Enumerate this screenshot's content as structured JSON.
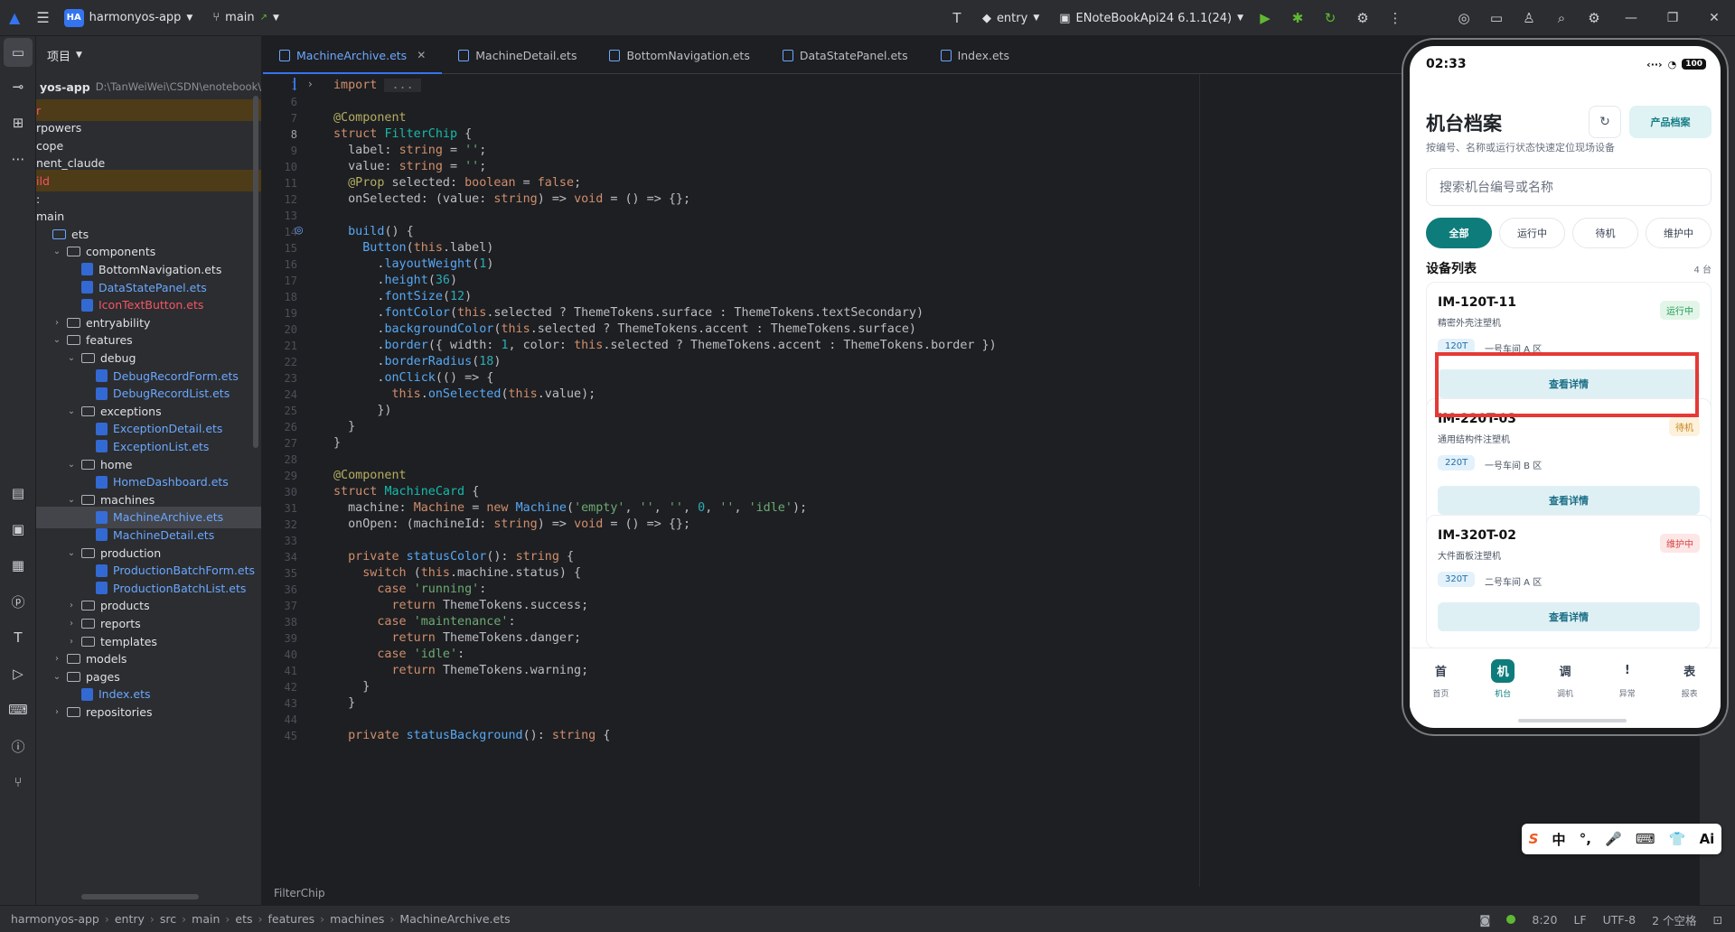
{
  "titlebar": {
    "project_badge": "HA",
    "project_name": "harmonyos-app",
    "branch": "main",
    "run_config": "entry",
    "device": "ENoteBookApi24 6.1.1(24)"
  },
  "project_panel": {
    "title": "项目",
    "root_name": "yos-app",
    "root_path": "D:\\TanWeiWei\\CSDN\\enotebook\\",
    "rows": [
      {
        "label": "r",
        "indent": 0,
        "type": "text",
        "state": "hl",
        "color": "red"
      },
      {
        "label": "rpowers",
        "indent": 0,
        "type": "text"
      },
      {
        "label": "cope",
        "indent": 0,
        "type": "text"
      },
      {
        "label": "nent_claude",
        "indent": 0,
        "type": "text"
      },
      {
        "label": "ild",
        "indent": 0,
        "type": "text",
        "state": "hl",
        "color": "red"
      },
      {
        "label": ":",
        "indent": 0,
        "type": "text"
      },
      {
        "label": "main",
        "indent": 0,
        "type": "text"
      },
      {
        "label": "ets",
        "indent": 0,
        "type": "folder"
      },
      {
        "label": "components",
        "indent": 1,
        "type": "folder",
        "arrow": "open"
      },
      {
        "label": "BottomNavigation.ets",
        "indent": 2,
        "type": "file"
      },
      {
        "label": "DataStatePanel.ets",
        "indent": 2,
        "type": "file",
        "color": "blue"
      },
      {
        "label": "IconTextButton.ets",
        "indent": 2,
        "type": "file",
        "color": "red"
      },
      {
        "label": "entryability",
        "indent": 1,
        "type": "folder",
        "arrow": "closed"
      },
      {
        "label": "features",
        "indent": 1,
        "type": "folder",
        "arrow": "open"
      },
      {
        "label": "debug",
        "indent": 2,
        "type": "folder",
        "arrow": "open"
      },
      {
        "label": "DebugRecordForm.ets",
        "indent": 3,
        "type": "file",
        "color": "blue"
      },
      {
        "label": "DebugRecordList.ets",
        "indent": 3,
        "type": "file",
        "color": "blue"
      },
      {
        "label": "exceptions",
        "indent": 2,
        "type": "folder",
        "arrow": "open"
      },
      {
        "label": "ExceptionDetail.ets",
        "indent": 3,
        "type": "file",
        "color": "blue"
      },
      {
        "label": "ExceptionList.ets",
        "indent": 3,
        "type": "file",
        "color": "blue"
      },
      {
        "label": "home",
        "indent": 2,
        "type": "folder",
        "arrow": "open"
      },
      {
        "label": "HomeDashboard.ets",
        "indent": 3,
        "type": "file",
        "color": "blue"
      },
      {
        "label": "machines",
        "indent": 2,
        "type": "folder",
        "arrow": "open"
      },
      {
        "label": "MachineArchive.ets",
        "indent": 3,
        "type": "file",
        "color": "blue",
        "state": "sel"
      },
      {
        "label": "MachineDetail.ets",
        "indent": 3,
        "type": "file",
        "color": "blue"
      },
      {
        "label": "production",
        "indent": 2,
        "type": "folder",
        "arrow": "open"
      },
      {
        "label": "ProductionBatchForm.ets",
        "indent": 3,
        "type": "file",
        "color": "blue"
      },
      {
        "label": "ProductionBatchList.ets",
        "indent": 3,
        "type": "file",
        "color": "blue"
      },
      {
        "label": "products",
        "indent": 2,
        "type": "folder",
        "arrow": "closed"
      },
      {
        "label": "reports",
        "indent": 2,
        "type": "folder",
        "arrow": "closed"
      },
      {
        "label": "templates",
        "indent": 2,
        "type": "folder",
        "arrow": "closed"
      },
      {
        "label": "models",
        "indent": 1,
        "type": "folder",
        "arrow": "closed"
      },
      {
        "label": "pages",
        "indent": 1,
        "type": "folder",
        "arrow": "open"
      },
      {
        "label": "Index.ets",
        "indent": 2,
        "type": "file",
        "color": "blue"
      },
      {
        "label": "repositories",
        "indent": 1,
        "type": "folder",
        "arrow": "closed"
      }
    ]
  },
  "tabs": [
    {
      "label": "MachineArchive.ets",
      "active": true,
      "closable": true
    },
    {
      "label": "MachineDetail.ets"
    },
    {
      "label": "BottomNavigation.ets"
    },
    {
      "label": "DataStatePanel.ets"
    },
    {
      "label": "Index.ets"
    }
  ],
  "code": {
    "current_line": "8",
    "lines": [
      {
        "n": "1",
        "html": "<span class='k'>import</span> <span class='g' style='background:#2b2d30'> ... </span>"
      },
      {
        "n": "6",
        "html": ""
      },
      {
        "n": "7",
        "html": "<span class='a'>@Component</span>"
      },
      {
        "n": "8",
        "html": "<span class='k'>struct</span> <span class='ty'>FilterChip</span> <span class='t'>{</span>"
      },
      {
        "n": "9",
        "html": "  <span class='t'>label: </span><span class='k'>string</span> <span class='t'>= </span><span class='s'>''</span><span class='t'>;</span>"
      },
      {
        "n": "10",
        "html": "  <span class='t'>value: </span><span class='k'>string</span> <span class='t'>= </span><span class='s'>''</span><span class='t'>;</span>"
      },
      {
        "n": "11",
        "html": "  <span class='a'>@Prop</span> <span class='t'>selected: </span><span class='k'>boolean</span> <span class='t'>= </span><span class='k'>false</span><span class='t'>;</span>"
      },
      {
        "n": "12",
        "html": "  <span class='t'>onSelected: (value: </span><span class='k'>string</span><span class='t'>) => </span><span class='k'>void</span> <span class='t'>= () => {};</span>"
      },
      {
        "n": "13",
        "html": ""
      },
      {
        "n": "14",
        "html": "  <span class='f'>build</span><span class='t'>() {</span>"
      },
      {
        "n": "15",
        "html": "    <span class='f'>Button</span><span class='t'>(</span><span class='k'>this</span><span class='t'>.label)</span>"
      },
      {
        "n": "16",
        "html": "      <span class='t'>.</span><span class='f'>layoutWeight</span><span class='t'>(</span><span class='n'>1</span><span class='t'>)</span>"
      },
      {
        "n": "17",
        "html": "      <span class='t'>.</span><span class='f'>height</span><span class='t'>(</span><span class='n'>36</span><span class='t'>)</span>"
      },
      {
        "n": "18",
        "html": "      <span class='t'>.</span><span class='f'>fontSize</span><span class='t'>(</span><span class='n'>12</span><span class='t'>)</span>"
      },
      {
        "n": "19",
        "html": "      <span class='t'>.</span><span class='f'>fontColor</span><span class='t'>(</span><span class='k'>this</span><span class='t'>.selected ? ThemeTokens.surface : ThemeTokens.textSecondary)</span>"
      },
      {
        "n": "20",
        "html": "      <span class='t'>.</span><span class='f'>backgroundColor</span><span class='t'>(</span><span class='k'>this</span><span class='t'>.selected ? ThemeTokens.accent : ThemeTokens.surface)</span>"
      },
      {
        "n": "21",
        "html": "      <span class='t'>.</span><span class='f'>border</span><span class='t'>({ width: </span><span class='n'>1</span><span class='t'>, color: </span><span class='k'>this</span><span class='t'>.selected ? ThemeTokens.accent : ThemeTokens.border })</span>"
      },
      {
        "n": "22",
        "html": "      <span class='t'>.</span><span class='f'>borderRadius</span><span class='t'>(</span><span class='n'>18</span><span class='t'>)</span>"
      },
      {
        "n": "23",
        "html": "      <span class='t'>.</span><span class='f'>onClick</span><span class='t'>(() => {</span>"
      },
      {
        "n": "24",
        "html": "        <span class='k'>this</span><span class='t'>.</span><span class='f'>onSelected</span><span class='t'>(</span><span class='k'>this</span><span class='t'>.value);</span>"
      },
      {
        "n": "25",
        "html": "      <span class='t'>})</span>"
      },
      {
        "n": "26",
        "html": "  <span class='t'>}</span>"
      },
      {
        "n": "27",
        "html": "<span class='t'>}</span>"
      },
      {
        "n": "28",
        "html": ""
      },
      {
        "n": "29",
        "html": "<span class='a'>@Component</span>"
      },
      {
        "n": "30",
        "html": "<span class='k'>struct</span> <span class='ty'>MachineCard</span> <span class='t'>{</span>"
      },
      {
        "n": "31",
        "html": "  <span class='t'>machine: </span><span class='k'>Machine</span> <span class='t'>= </span><span class='k'>new</span> <span class='f'>Machine</span><span class='t'>(</span><span class='s'>'empty'</span><span class='t'>, </span><span class='s'>''</span><span class='t'>, </span><span class='s'>''</span><span class='t'>, </span><span class='n'>0</span><span class='t'>, </span><span class='s'>''</span><span class='t'>, </span><span class='s'>'idle'</span><span class='t'>);</span>"
      },
      {
        "n": "32",
        "html": "  <span class='t'>onOpen: (machineId: </span><span class='k'>string</span><span class='t'>) => </span><span class='k'>void</span> <span class='t'>= () => {};</span>"
      },
      {
        "n": "33",
        "html": ""
      },
      {
        "n": "34",
        "html": "  <span class='k'>private</span> <span class='f'>statusColor</span><span class='t'>(): </span><span class='k'>string</span> <span class='t'>{</span>"
      },
      {
        "n": "35",
        "html": "    <span class='k'>switch</span> <span class='t'>(</span><span class='k'>this</span><span class='t'>.machine.status) {</span>"
      },
      {
        "n": "36",
        "html": "      <span class='k'>case</span> <span class='s'>'running'</span><span class='t'>:</span>"
      },
      {
        "n": "37",
        "html": "        <span class='k'>return</span> <span class='t'>ThemeTokens.success;</span>"
      },
      {
        "n": "38",
        "html": "      <span class='k'>case</span> <span class='s'>'maintenance'</span><span class='t'>:</span>"
      },
      {
        "n": "39",
        "html": "        <span class='k'>return</span> <span class='t'>ThemeTokens.danger;</span>"
      },
      {
        "n": "40",
        "html": "      <span class='k'>case</span> <span class='s'>'idle'</span><span class='t'>:</span>"
      },
      {
        "n": "41",
        "html": "        <span class='k'>return</span> <span class='t'>ThemeTokens.warning;</span>"
      },
      {
        "n": "42",
        "html": "    <span class='t'>}</span>"
      },
      {
        "n": "43",
        "html": "  <span class='t'>}</span>"
      },
      {
        "n": "44",
        "html": ""
      },
      {
        "n": "45",
        "html": "  <span class='k'>private</span> <span class='f'>statusBackground</span><span class='t'>(): </span><span class='k'>string</span> <span class='t'>{</span>"
      }
    ]
  },
  "editor_breadcrumb": "FilterChip",
  "statusbar": {
    "crumbs": [
      "harmonyos-app",
      "entry",
      "src",
      "main",
      "ets",
      "features",
      "machines",
      "MachineArchive.ets"
    ],
    "position": "8:20",
    "line_sep": "LF",
    "encoding": "UTF-8",
    "indent": "2 个空格"
  },
  "phone": {
    "time": "02:33",
    "battery": "100",
    "title": "机台档案",
    "subtitle": "按编号、名称或运行状态快速定位现场设备",
    "product_button": "产品档案",
    "search_placeholder": "搜索机台编号或名称",
    "chips": [
      "全部",
      "运行中",
      "待机",
      "维护中"
    ],
    "list_title": "设备列表",
    "list_count": "4 台",
    "detail_label": "查看详情",
    "cards": [
      {
        "id": "IM-120T-11",
        "name": "精密外壳注塑机",
        "status": "运行中",
        "ton": "120T",
        "area": "一号车间 A 区",
        "status_bg": "#e3f5e8",
        "status_fg": "#1f9d55"
      },
      {
        "id": "IM-220T-03",
        "name": "通用结构件注塑机",
        "status": "待机",
        "ton": "220T",
        "area": "一号车间 B 区",
        "status_bg": "#fdf1dc",
        "status_fg": "#c7851b"
      },
      {
        "id": "IM-320T-02",
        "name": "大件面板注塑机",
        "status": "维护中",
        "ton": "320T",
        "area": "二号车间 A 区",
        "status_bg": "#fde6e6",
        "status_fg": "#d64545"
      }
    ],
    "nav": [
      {
        "glyph": "首",
        "label": "首页"
      },
      {
        "glyph": "机",
        "label": "机台",
        "active": true
      },
      {
        "glyph": "调",
        "label": "调机"
      },
      {
        "glyph": "!",
        "label": "异常"
      },
      {
        "glyph": "表",
        "label": "报表"
      }
    ]
  },
  "ime": [
    "S",
    "中",
    "°,",
    "🎤",
    "⌨",
    "👕",
    "Ai"
  ]
}
